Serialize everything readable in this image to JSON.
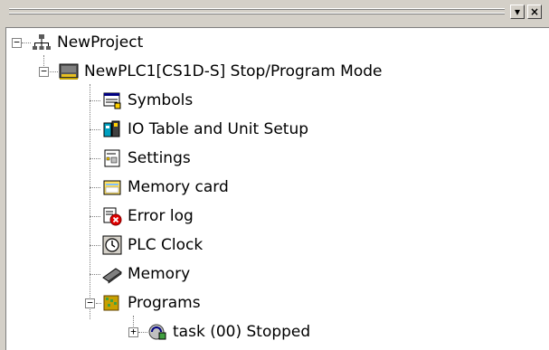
{
  "pane": {
    "minimize_label": "▾",
    "close_label": "×"
  },
  "tree": {
    "root": {
      "label": "NewProject",
      "icon": "network-icon"
    },
    "plc": {
      "label": "NewPLC1[CS1D-S] Stop/Program Mode",
      "icon": "plc-icon"
    },
    "items": [
      {
        "label": "Symbols",
        "icon": "symbols-icon"
      },
      {
        "label": "IO Table and Unit Setup",
        "icon": "io-table-icon"
      },
      {
        "label": "Settings",
        "icon": "settings-icon"
      },
      {
        "label": "Memory card",
        "icon": "memory-card-icon"
      },
      {
        "label": "Error log",
        "icon": "error-log-icon"
      },
      {
        "label": "PLC Clock",
        "icon": "clock-icon"
      },
      {
        "label": "Memory",
        "icon": "memory-icon"
      }
    ],
    "programs": {
      "label": "Programs",
      "icon": "programs-icon"
    },
    "task": {
      "label": "task (00) Stopped",
      "icon": "task-icon"
    }
  }
}
